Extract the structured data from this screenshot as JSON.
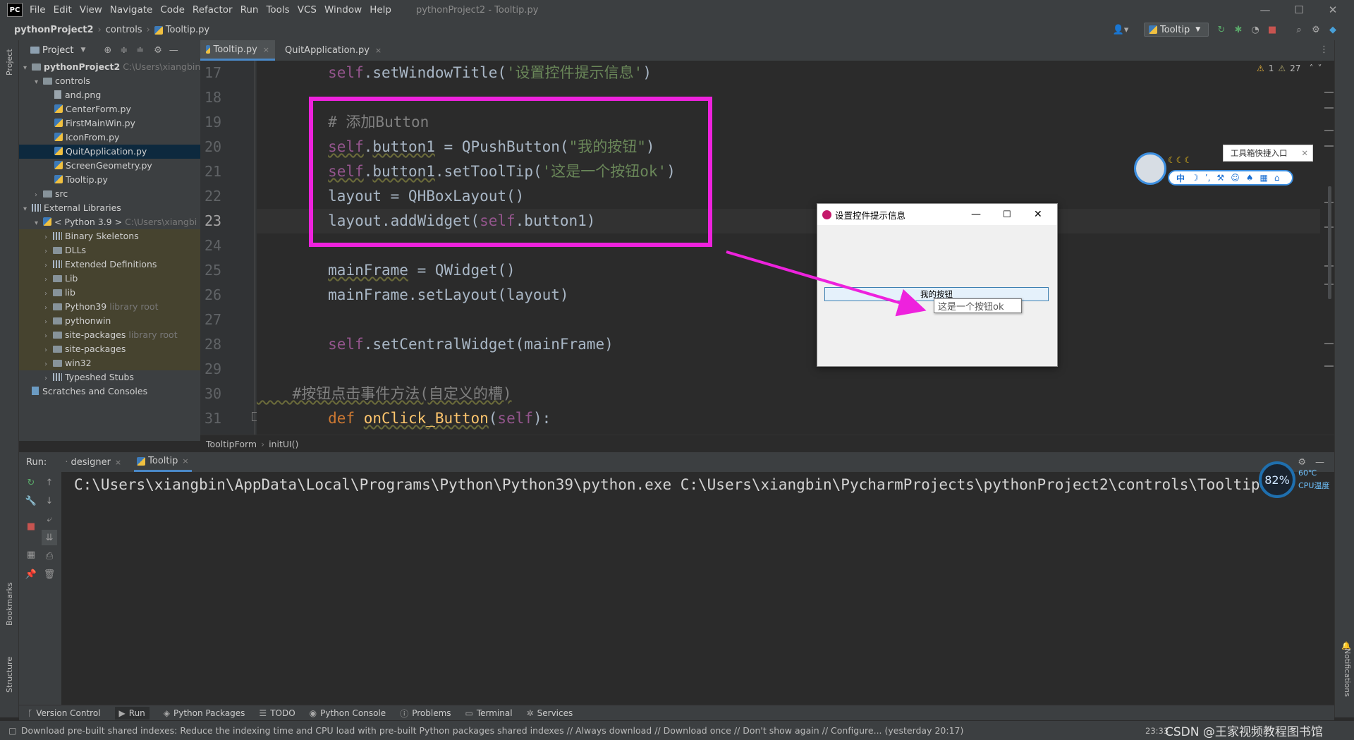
{
  "menubar": {
    "logo": "PC",
    "items": [
      "File",
      "Edit",
      "View",
      "Navigate",
      "Code",
      "Refactor",
      "Run",
      "Tools",
      "VCS",
      "Window",
      "Help"
    ],
    "window_title": "pythonProject2 - Tooltip.py"
  },
  "navbar": {
    "crumbs": [
      "pythonProject2",
      "controls",
      "Tooltip.py"
    ],
    "run_config": "Tooltip"
  },
  "project": {
    "title": "Project",
    "tree": [
      {
        "label": "pythonProject2",
        "hint": "C:\\Users\\xiangbin\\",
        "icon": "folder"
      },
      {
        "label": "controls",
        "hint": "",
        "icon": "folder"
      },
      {
        "label": "and.png",
        "hint": "",
        "icon": "file"
      },
      {
        "label": "CenterForm.py",
        "hint": "",
        "icon": "python"
      },
      {
        "label": "FirstMainWin.py",
        "hint": "",
        "icon": "python"
      },
      {
        "label": "IconFrom.py",
        "hint": "",
        "icon": "python"
      },
      {
        "label": "QuitApplication.py",
        "hint": "",
        "icon": "python"
      },
      {
        "label": "ScreenGeometry.py",
        "hint": "",
        "icon": "python"
      },
      {
        "label": "Tooltip.py",
        "hint": "",
        "icon": "python"
      },
      {
        "label": "src",
        "hint": "",
        "icon": "folder"
      },
      {
        "label": "External Libraries",
        "hint": "",
        "icon": "library"
      },
      {
        "label": "< Python 3.9 >",
        "hint": "C:\\Users\\xiangbi",
        "icon": "python"
      },
      {
        "label": "Binary Skeletons",
        "hint": "",
        "icon": "library"
      },
      {
        "label": "DLLs",
        "hint": "",
        "icon": "folder"
      },
      {
        "label": "Extended Definitions",
        "hint": "",
        "icon": "library"
      },
      {
        "label": "Lib",
        "hint": "",
        "icon": "folder"
      },
      {
        "label": "lib",
        "hint": "",
        "icon": "folder"
      },
      {
        "label": "Python39",
        "hint": "library root",
        "icon": "folder"
      },
      {
        "label": "pythonwin",
        "hint": "",
        "icon": "folder"
      },
      {
        "label": "site-packages",
        "hint": "library root",
        "icon": "folder"
      },
      {
        "label": "site-packages",
        "hint": "",
        "icon": "folder"
      },
      {
        "label": "win32",
        "hint": "",
        "icon": "folder"
      },
      {
        "label": "Typeshed Stubs",
        "hint": "",
        "icon": "library"
      },
      {
        "label": "Scratches and Consoles",
        "hint": "",
        "icon": "scratch"
      }
    ]
  },
  "left_tabs": {
    "project": "Project",
    "bookmarks": "Bookmarks",
    "structure": "Structure"
  },
  "right_tabs": {
    "notifications": "Notifications"
  },
  "editor": {
    "tabs": [
      "Tooltip.py",
      "QuitApplication.py"
    ],
    "inspections": {
      "warnings": "1",
      "weak_warnings": "27"
    },
    "line_numbers": [
      "17",
      "18",
      "19",
      "20",
      "21",
      "22",
      "23",
      "24",
      "25",
      "26",
      "27",
      "28",
      "29",
      "30",
      "31"
    ],
    "code": {
      "l17_a": "        ",
      "l17_self": "self",
      "l17_b": ".setWindowTitle(",
      "l17_str": "'设置控件提示信息'",
      "l17_c": ")",
      "l19": "        # 添加Button",
      "l20_a": "        ",
      "l20_self": "self",
      "l20_b": ".",
      "l20_attr": "button1",
      "l20_c": " = QPushButton(",
      "l20_str": "\"我的按钮\"",
      "l20_d": ")",
      "l21_a": "        ",
      "l21_self": "self",
      "l21_b": ".",
      "l21_attr": "button1",
      "l21_c": ".setToolTip(",
      "l21_str": "'这是一个按钮ok'",
      "l21_d": ")",
      "l22": "        layout = QHBoxLayout()",
      "l23_a": "        layout.addWidget(",
      "l23_self": "self",
      "l23_b": ".button1)",
      "l25_a": "        ",
      "l25_var": "mainFrame",
      "l25_b": " = QWidget()",
      "l26": "        mainFrame.setLayout(layout)",
      "l28_a": "        ",
      "l28_self": "self",
      "l28_b": ".setCentralWidget(mainFrame)",
      "l30": "    #按钮点击事件方法(自定义的槽)",
      "l31_a": "        ",
      "l31_kw": "def",
      "l31_sp": " ",
      "l31_fn": "onClick_Button",
      "l31_b": "(",
      "l31_self": "self",
      "l31_c": "):"
    },
    "breadcrumbs": [
      "TooltipForm",
      "initUI()"
    ]
  },
  "run": {
    "label": "Run:",
    "tabs": [
      "designer",
      "Tooltip"
    ],
    "console_line": "C:\\Users\\xiangbin\\AppData\\Local\\Programs\\Python\\Python39\\python.exe C:\\Users\\xiangbin\\PycharmProjects\\pythonProject2\\controls\\Tooltip.py"
  },
  "bottom_tools": [
    "Version Control",
    "Run",
    "Python Packages",
    "TODO",
    "Python Console",
    "Problems",
    "Terminal",
    "Services"
  ],
  "status": {
    "message": "Download pre-built shared indexes: Reduce the indexing time and CPU load with pre-built Python packages shared indexes // Always download // Download once // Don't show again // Configure... (yesterday 20:17)",
    "time": "23:33",
    "watermark": "CSDN @王家视频教程图书馆"
  },
  "qt_window": {
    "title": "设置控件提示信息",
    "button_label": "我的按钮",
    "tooltip_text": "这是一个按钮ok"
  },
  "overlay_widget": {
    "label": "工具箱快捷入口",
    "toolbar_char": "中",
    "moons": "☾☾☾"
  },
  "hw_monitor": {
    "cpu_usage": "82%",
    "cpu_temp": "60℃",
    "cpu_temp_label": "CPU温度"
  },
  "colors": {
    "highlight_box": "#ee22dd",
    "arrow": "#ee22dd",
    "keyword": "#cc7832",
    "self": "#94558d",
    "string": "#6a8759",
    "comment": "#808080"
  }
}
